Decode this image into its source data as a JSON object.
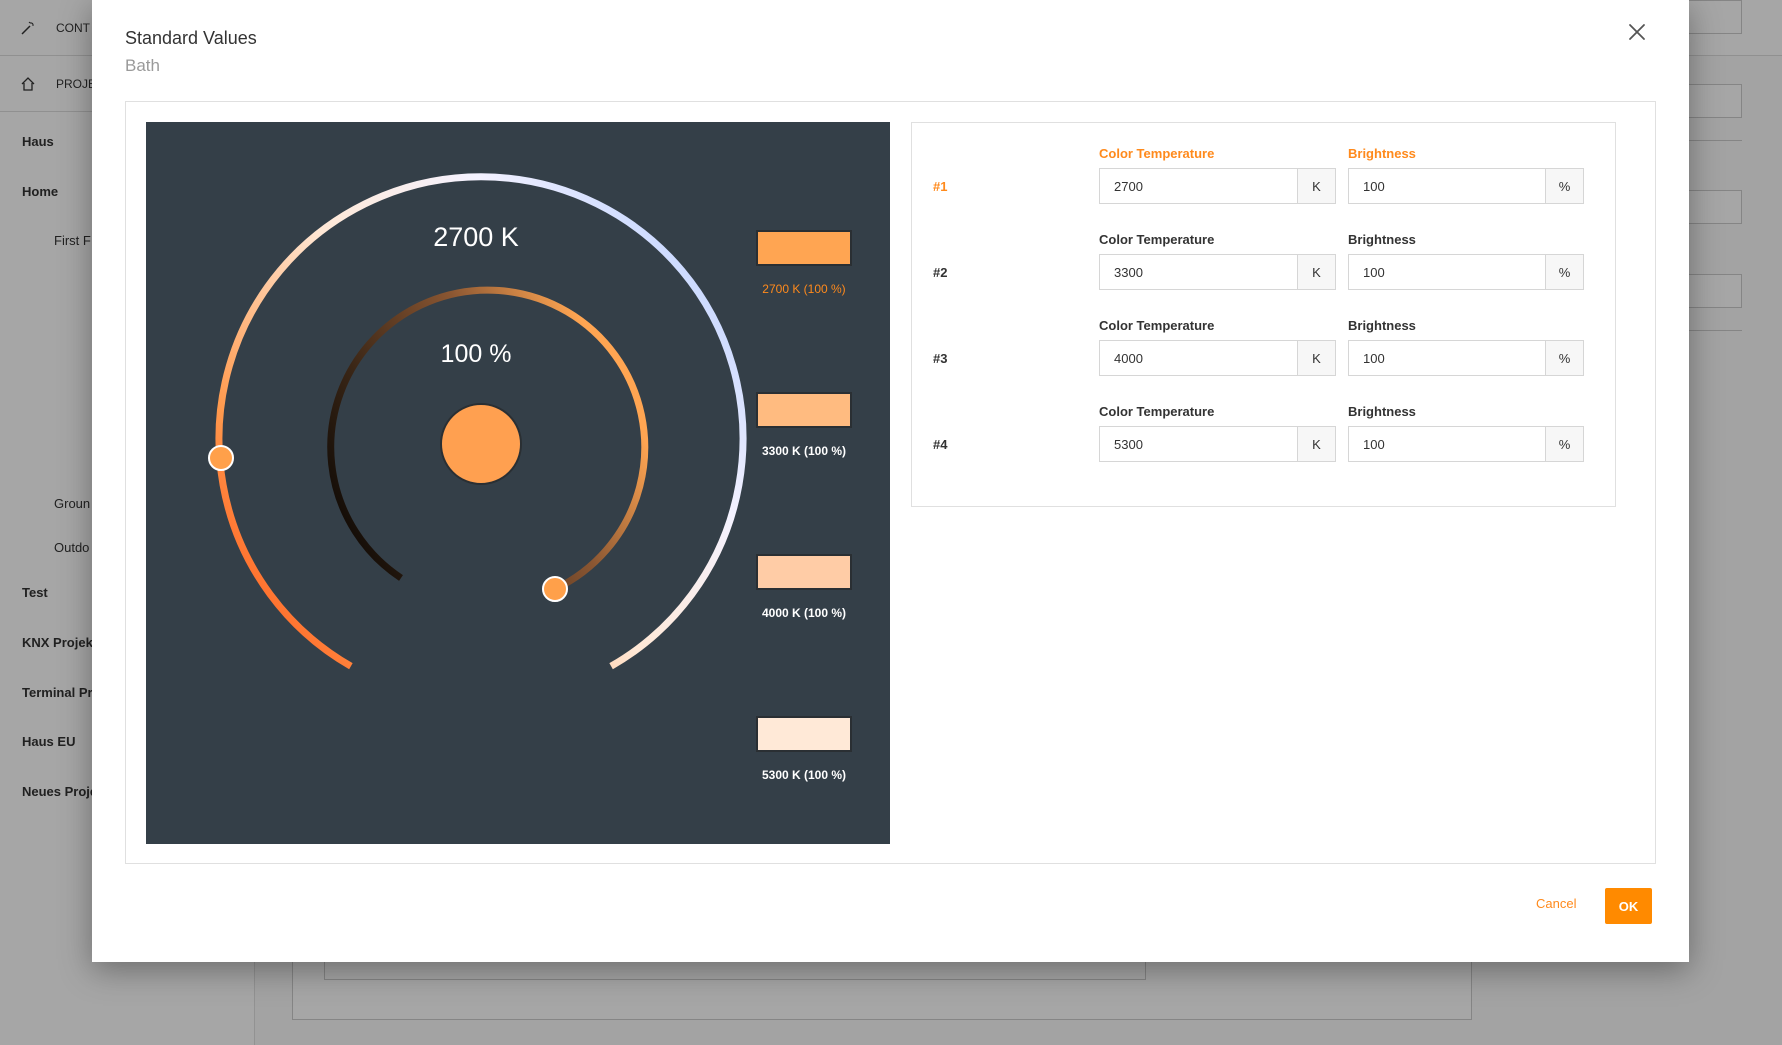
{
  "background": {
    "topbar_label": "CONT",
    "nav_label": "PROJE",
    "tree": [
      "Haus",
      "Home",
      "First F",
      "Groun",
      "Outdo",
      "Test",
      "KNX Projekt",
      "Terminal Pr",
      "Haus EU",
      "Neues Proje"
    ]
  },
  "dialog": {
    "title": "Standard Values",
    "subtitle": "Bath",
    "close_icon": "close-icon"
  },
  "picker": {
    "kelvin": "2700 K",
    "brightness": "100 %",
    "current_color": "#ffa050",
    "temperature_slider_value_k": 2700,
    "brightness_slider_value_pct": 100,
    "presets": [
      {
        "label": "2700 K (100 %)",
        "color": "#ffa552"
      },
      {
        "label": "3300 K (100 %)",
        "color": "#ffbb80"
      },
      {
        "label": "4000 K (100 %)",
        "color": "#ffcca6"
      },
      {
        "label": "5300 K (100 %)",
        "color": "#ffe9d7"
      }
    ]
  },
  "form": {
    "rows": [
      {
        "num": "#1",
        "ct_label": "Color Temperature",
        "ct_value": "2700",
        "ct_unit": "K",
        "br_label": "Brightness",
        "br_value": "100",
        "br_unit": "%"
      },
      {
        "num": "#2",
        "ct_label": "Color Temperature",
        "ct_value": "3300",
        "ct_unit": "K",
        "br_label": "Brightness",
        "br_value": "100",
        "br_unit": "%"
      },
      {
        "num": "#3",
        "ct_label": "Color Temperature",
        "ct_value": "4000",
        "ct_unit": "K",
        "br_label": "Brightness",
        "br_value": "100",
        "br_unit": "%"
      },
      {
        "num": "#4",
        "ct_label": "Color Temperature",
        "ct_value": "5300",
        "ct_unit": "K",
        "br_label": "Brightness",
        "br_value": "100",
        "br_unit": "%"
      }
    ]
  },
  "footer": {
    "cancel_label": "Cancel",
    "ok_label": "OK"
  },
  "colors": {
    "accent": "#ff8a00",
    "picker_bg": "#343f48"
  }
}
